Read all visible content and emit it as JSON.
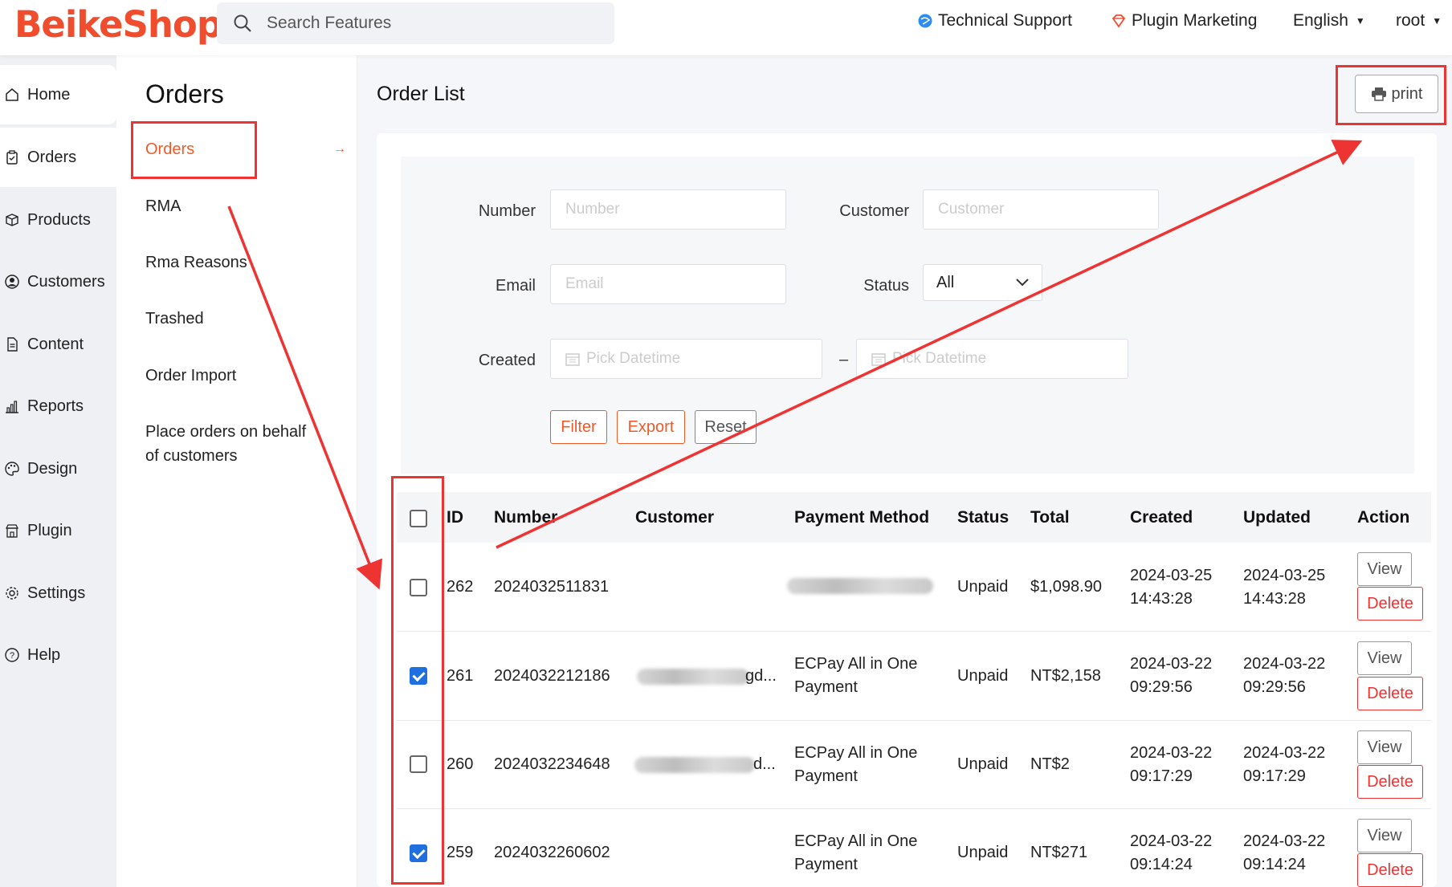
{
  "header": {
    "logo": "BeikeShop",
    "search_placeholder": "Search Features",
    "technical_support": "Technical Support",
    "plugin_marketing": "Plugin Marketing",
    "language": "English",
    "user": "root"
  },
  "sidebar": {
    "items": [
      {
        "label": "Home",
        "icon": "home-icon"
      },
      {
        "label": "Orders",
        "icon": "clipboard-icon"
      },
      {
        "label": "Products",
        "icon": "box-icon"
      },
      {
        "label": "Customers",
        "icon": "user-icon"
      },
      {
        "label": "Content",
        "icon": "document-icon"
      },
      {
        "label": "Reports",
        "icon": "bar-chart-icon"
      },
      {
        "label": "Design",
        "icon": "palette-icon"
      },
      {
        "label": "Plugin",
        "icon": "store-icon"
      },
      {
        "label": "Settings",
        "icon": "gear-icon"
      },
      {
        "label": "Help",
        "icon": "help-icon"
      }
    ]
  },
  "subnav": {
    "title": "Orders",
    "items": [
      {
        "label": "Orders"
      },
      {
        "label": "RMA"
      },
      {
        "label": "Rma Reasons"
      },
      {
        "label": "Trashed"
      },
      {
        "label": "Order Import"
      },
      {
        "label": "Place orders on behalf"
      },
      {
        "label": "of customers"
      }
    ]
  },
  "main": {
    "title": "Order List",
    "print_label": "print"
  },
  "filter": {
    "number_label": "Number",
    "number_placeholder": "Number",
    "customer_label": "Customer",
    "customer_placeholder": "Customer",
    "email_label": "Email",
    "email_placeholder": "Email",
    "status_label": "Status",
    "status_value": "All",
    "created_label": "Created",
    "date_placeholder": "Pick Datetime",
    "date_sep": "–",
    "filter_btn": "Filter",
    "export_btn": "Export",
    "reset_btn": "Reset"
  },
  "table": {
    "headers": {
      "id": "ID",
      "number": "Number",
      "customer": "Customer",
      "payment": "Payment Method",
      "status": "Status",
      "total": "Total",
      "created": "Created",
      "updated": "Updated",
      "action": "Action"
    },
    "view_label": "View",
    "delete_label": "Delete",
    "rows": [
      {
        "id": "262",
        "number": "2024032511831",
        "customer": "",
        "payment1": "",
        "payment2": "",
        "status": "Unpaid",
        "total": "$1,098.90",
        "created_date": "2024-03-25",
        "created_time": "14:43:28",
        "updated_date": "2024-03-25",
        "updated_time": "14:43:28",
        "checked": false
      },
      {
        "id": "261",
        "number": "2024032212186",
        "customer": "gd...",
        "payment1": "ECPay All in One",
        "payment2": "Payment",
        "status": "Unpaid",
        "total": "NT$2,158",
        "created_date": "2024-03-22",
        "created_time": "09:29:56",
        "updated_date": "2024-03-22",
        "updated_time": "09:29:56",
        "checked": true
      },
      {
        "id": "260",
        "number": "2024032234648",
        "customer": "d...",
        "payment1": "ECPay All in One",
        "payment2": "Payment",
        "status": "Unpaid",
        "total": "NT$2",
        "created_date": "2024-03-22",
        "created_time": "09:17:29",
        "updated_date": "2024-03-22",
        "updated_time": "09:17:29",
        "checked": false
      },
      {
        "id": "259",
        "number": "2024032260602",
        "customer": "",
        "payment1": "ECPay All in One",
        "payment2": "Payment",
        "status": "Unpaid",
        "total": "NT$271",
        "created_date": "2024-03-22",
        "created_time": "09:14:24",
        "updated_date": "2024-03-22",
        "updated_time": "09:14:24",
        "checked": true
      }
    ]
  },
  "colors": {
    "brand": "#ef4d2e",
    "accent": "#ef5a2a",
    "annotation": "#e33"
  }
}
